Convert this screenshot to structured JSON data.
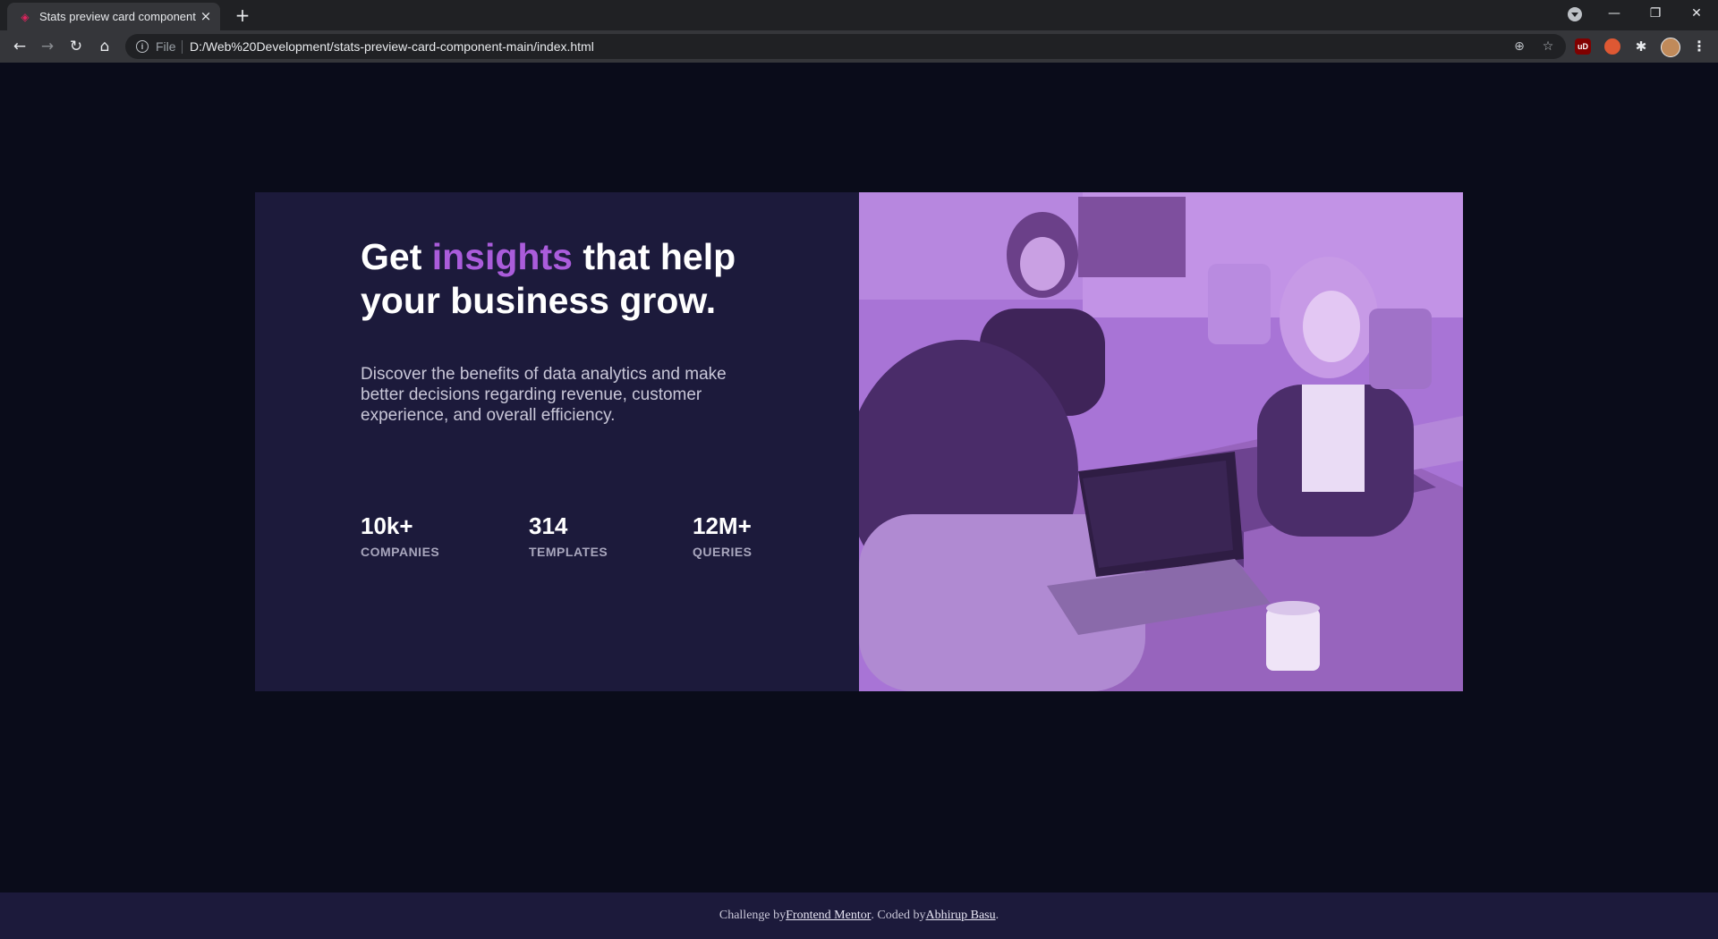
{
  "browser": {
    "tab_title": "Stats preview card component",
    "tab_close": "×",
    "new_tab": "+",
    "url_scheme": "File",
    "url": "D:/Web%20Development/stats-preview-card-component-main/index.html",
    "window_controls": {
      "minimize": "—",
      "restore": "❐",
      "close": "✕"
    },
    "nav": {
      "back": "←",
      "forward": "→",
      "reload": "↻",
      "home": "⌂"
    },
    "extensions": {
      "ublock": "uD",
      "puzzle": "✱",
      "menu": "⋮"
    }
  },
  "card": {
    "headline_prefix": "Get ",
    "headline_accent": "insights",
    "headline_suffix": " that help your business grow.",
    "description": "Discover the benefits of data analytics and make better decisions regarding revenue, customer experience, and overall efficiency.",
    "stats": [
      {
        "value": "10k+",
        "label": "COMPANIES"
      },
      {
        "value": "314",
        "label": "TEMPLATES"
      },
      {
        "value": "12M+",
        "label": "QUERIES"
      }
    ],
    "colors": {
      "card_bg": "#1c1a3b",
      "accent": "#aa5cdb",
      "page_bg": "#0a0c1a",
      "image_tint": "#a874d6"
    }
  },
  "footer": {
    "prefix": "Challenge by ",
    "link1": "Frontend Mentor",
    "middle": ". Coded by ",
    "link2": "Abhirup Basu",
    "suffix": "."
  }
}
